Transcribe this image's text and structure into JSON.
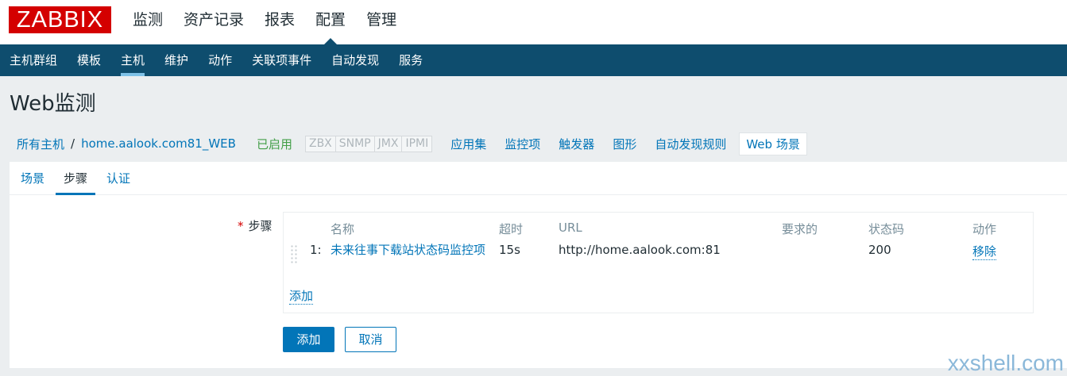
{
  "logo": "ZABBIX",
  "top_nav": [
    {
      "label": "监测"
    },
    {
      "label": "资产记录"
    },
    {
      "label": "报表"
    },
    {
      "label": "配置",
      "active": true
    },
    {
      "label": "管理"
    }
  ],
  "sub_nav": [
    {
      "label": "主机群组"
    },
    {
      "label": "模板"
    },
    {
      "label": "主机",
      "active": true
    },
    {
      "label": "维护"
    },
    {
      "label": "动作"
    },
    {
      "label": "关联项事件"
    },
    {
      "label": "自动发现"
    },
    {
      "label": "服务"
    }
  ],
  "page_title": "Web监测",
  "hostbar": {
    "all_hosts": "所有主机",
    "separator": "/",
    "host_name": "home.aalook.com81_WEB",
    "status": "已启用",
    "availability": [
      "ZBX",
      "SNMP",
      "JMX",
      "IPMI"
    ],
    "tabs": [
      "应用集",
      "监控项",
      "触发器",
      "图形",
      "自动发现规则",
      "Web 场景"
    ]
  },
  "form_tabs": [
    {
      "label": "场景"
    },
    {
      "label": "步骤",
      "active": true
    },
    {
      "label": "认证"
    }
  ],
  "steps": {
    "required_mark": "*",
    "label": "步骤",
    "columns": {
      "name": "名称",
      "timeout": "超时",
      "url": "URL",
      "required": "要求的",
      "status_code": "状态码",
      "action": "动作"
    },
    "rows": [
      {
        "index": "1:",
        "name": "未来往事下载站状态码监控项",
        "timeout": "15s",
        "url": "http://home.aalook.com:81",
        "required": "",
        "status_code": "200",
        "action": "移除"
      }
    ],
    "add_link": "添加"
  },
  "buttons": {
    "add": "添加",
    "cancel": "取消"
  },
  "watermark": "xxshell.com",
  "colors": {
    "brand_red": "#d40000",
    "nav_blue": "#0e4d6e",
    "link_blue": "#0275b8",
    "enabled_green": "#429e47"
  }
}
